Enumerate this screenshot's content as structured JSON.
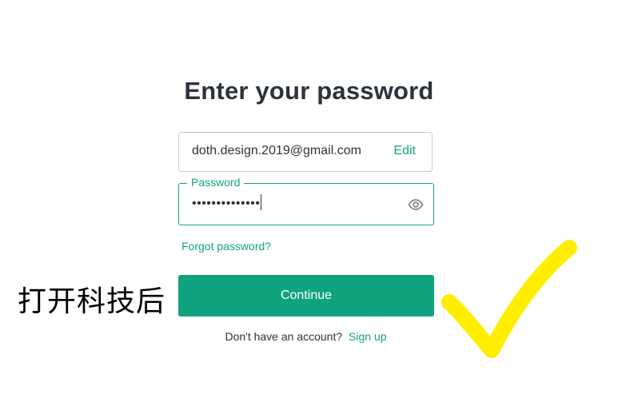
{
  "page": {
    "title": "Enter your password"
  },
  "email_field": {
    "value": "doth.design.2019@gmail.com",
    "edit_label": "Edit"
  },
  "password_field": {
    "label": "Password",
    "value": "••••••••••••••"
  },
  "forgot_password": {
    "label": "Forgot password?"
  },
  "continue_button": {
    "label": "Continue"
  },
  "signup": {
    "prompt": "Don't have an account?",
    "link_label": "Sign up"
  },
  "annotation": {
    "text": "打开科技后",
    "checkmark_color": "#ffee00"
  },
  "colors": {
    "accent": "#10a37f",
    "text": "#2d333a",
    "border": "#c2c8d0"
  },
  "icons": {
    "password_toggle": "eye-icon"
  }
}
